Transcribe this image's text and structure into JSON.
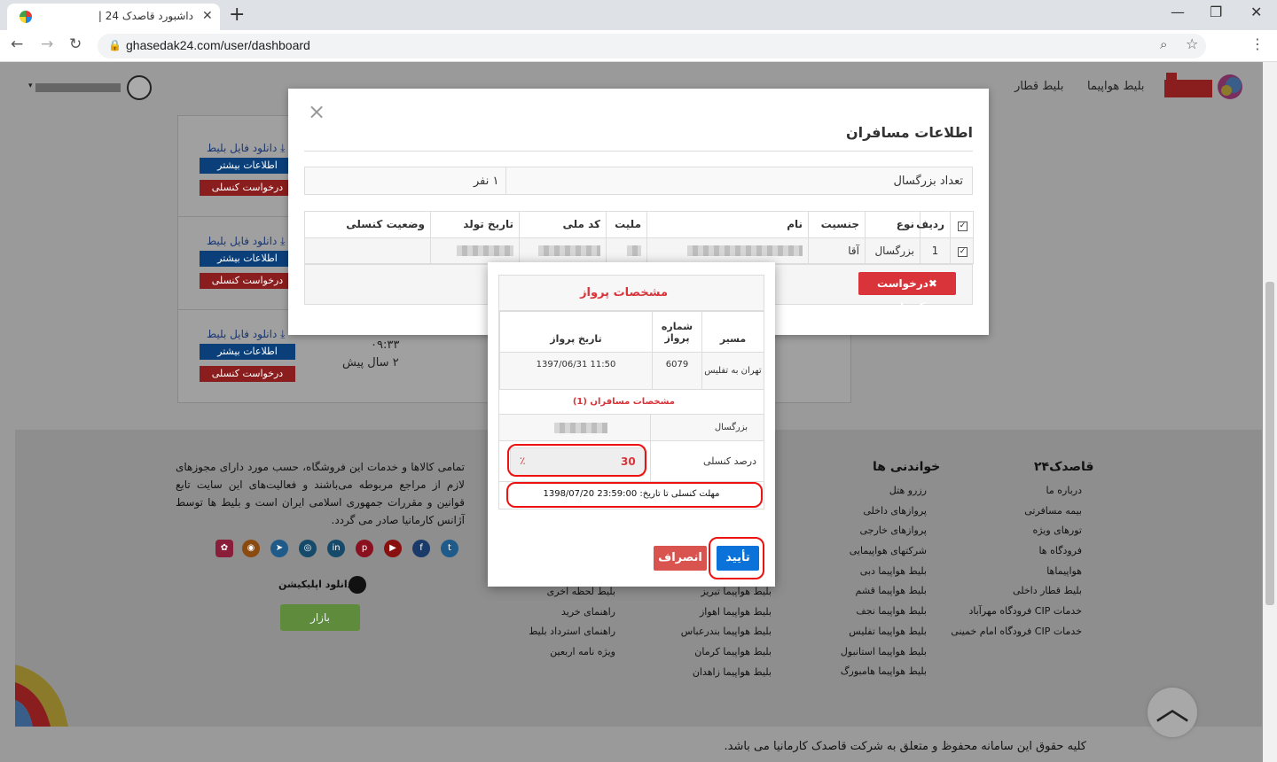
{
  "browser": {
    "tab_title": "داشبورد قاصدک 24 |",
    "url": "ghasedak24.com/user/dashboard"
  },
  "header": {
    "nav": [
      "بلیط هواپیما",
      "بلیط قطار"
    ]
  },
  "list": {
    "rows": [
      {
        "download": "دانلود فایل بلیط",
        "more": "اطلاعات بیشتر",
        "cancel": "درخواست کنسلی"
      },
      {
        "download": "دانلود فایل بلیط",
        "more": "اطلاعات بیشتر",
        "cancel": "درخواست کنسلی"
      },
      {
        "download": "دانلود فایل بلیط",
        "more": "اطلاعات بیشتر",
        "cancel": "درخواست کنسلی",
        "time": "۰۹:۳۳",
        "ago": "۲ سال پیش"
      }
    ]
  },
  "modal": {
    "title": "اطلاعات مسافران",
    "adult_label": "تعداد بزرگسال",
    "adult_value": "۱ نفر",
    "columns": [
      "ردیف",
      "نوع",
      "جنسیت",
      "نام",
      "ملیت",
      "کد ملی",
      "تاریخ تولد",
      "وضعیت کنسلی"
    ],
    "row": {
      "index": "1",
      "type": "بزرگسال",
      "gender": "آقا"
    },
    "cancel_request": "✖درخواست کنسلی"
  },
  "dialog": {
    "title": "مشخصات پرواز",
    "columns": [
      "مسیر",
      "شماره پرواز",
      "تاریخ پرواز"
    ],
    "flight": {
      "route": "تهران به تفلیس",
      "number": "6079",
      "date": "1397/06/31 11:50"
    },
    "pax_title": "مشخصات مسافران (1)",
    "pax_type": "بزرگسال",
    "pct_label": "درصد کنسلی",
    "pct_value": "30",
    "pct_symbol": "٪",
    "deadline": "مهلت کنسلی تا تاریخ: 23:59:00 1398/07/20",
    "confirm": "تأیید",
    "dismiss": "انصراف"
  },
  "footer": {
    "col1_title": "قاصدک۲۴",
    "col1_links": [
      "درباره ما",
      "بیمه مسافرتی",
      "تورهای ویژه",
      "فرودگاه ها",
      "هواپیماها",
      "بلیط قطار داخلی",
      "خدمات CIP فرودگاه مهرآباد",
      "خدمات CIP فرودگاه امام خمینی"
    ],
    "col2_title": "خواندنی ها",
    "col2_links": [
      "رزرو هتل",
      "پروازهای داخلی",
      "پروازهای خارجی",
      "شرکتهای هواپیمایی",
      "بلیط هواپیما دبی",
      "بلیط هواپیما قشم",
      "بلیط هواپیما نجف",
      "بلیط هواپیما تفلیس",
      "بلیط هواپیما استانبول",
      "بلیط هواپیما هامبورگ"
    ],
    "col3_links": [
      "بلیط هواپیما تبریز",
      "بلیط هواپیما اهواز",
      "بلیط هواپیما بندرعباس",
      "بلیط هواپیما کرمان",
      "بلیط هواپیما زاهدان"
    ],
    "col4_links": [
      "بلیط لحظه آخری",
      "راهنمای خرید",
      "راهنمای استرداد بلیط",
      "ویژه نامه اربعین"
    ],
    "about": "تمامی کالاها و خدمات این فروشگاه، حسب مورد دارای مجوزهای لازم از مراجع مربوطه می‌باشند و فعالیت‌های این سایت تابع قوانین و مقررات جمهوری اسلامی ایران است و بلیط ها توسط آژانس کارمانیا صادر می گردد.",
    "app_download": "دانلود اپلیکیشن",
    "bazaar": "بازار",
    "copyright": "کلیه حقوق این سامانه محفوظ و متعلق به شرکت قاصدک کارمانیا می باشد."
  },
  "colors": {
    "accent_red": "#d9343a",
    "confirm_blue": "#0a72d8",
    "annotation_red": "#ee1111"
  }
}
